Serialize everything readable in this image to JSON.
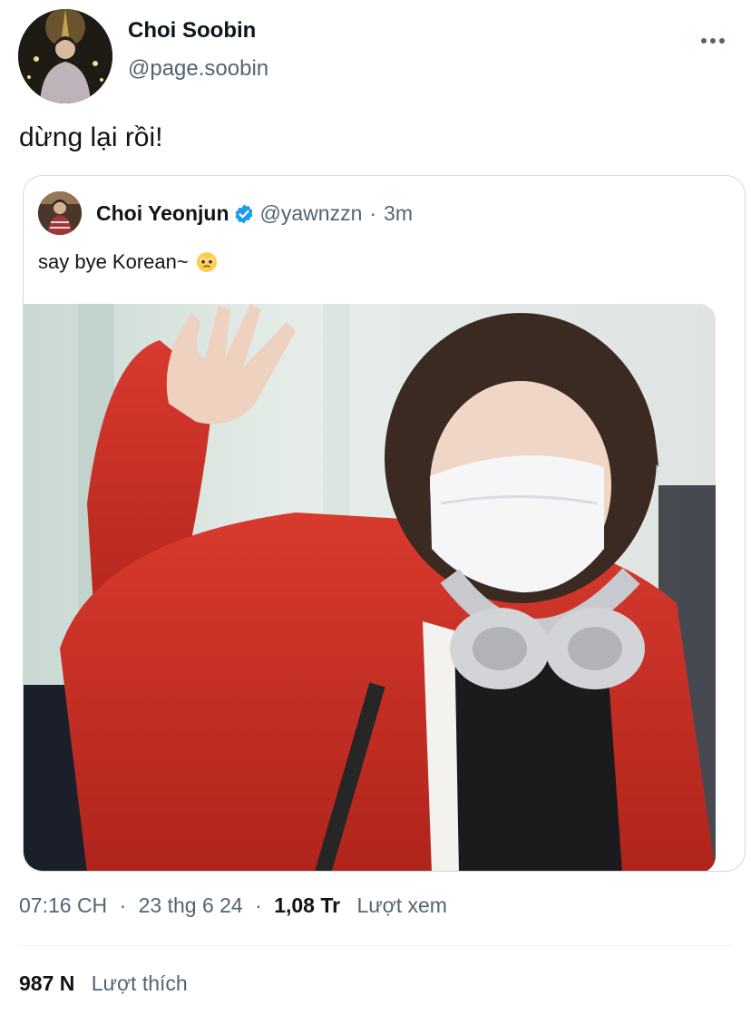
{
  "tweet": {
    "author_name": "Choi Soobin",
    "author_handle": "@page.soobin",
    "text": "dừng lại rồi!",
    "more_icon": "more-horizontal-icon"
  },
  "quoted_tweet": {
    "author_name": "Choi Yeonjun",
    "author_handle": "@yawnzzn",
    "separator": "·",
    "time": "3m",
    "text": "say bye Korean~",
    "emoji": "pleading-face-emoji",
    "verified_icon": "verified-badge-icon"
  },
  "meta": {
    "time": "07:16 CH",
    "separator1": "·",
    "date": "23 thg 6 24",
    "separator2": "·",
    "views_count": "1,08 Tr",
    "views_label": "Lượt xem"
  },
  "engagement": {
    "likes_count": "987 N",
    "likes_label": "Lượt thích"
  },
  "colors": {
    "text_primary": "#0f1419",
    "text_secondary": "#536471",
    "verified_blue": "#1d9bf0",
    "border": "#cfd9de"
  }
}
